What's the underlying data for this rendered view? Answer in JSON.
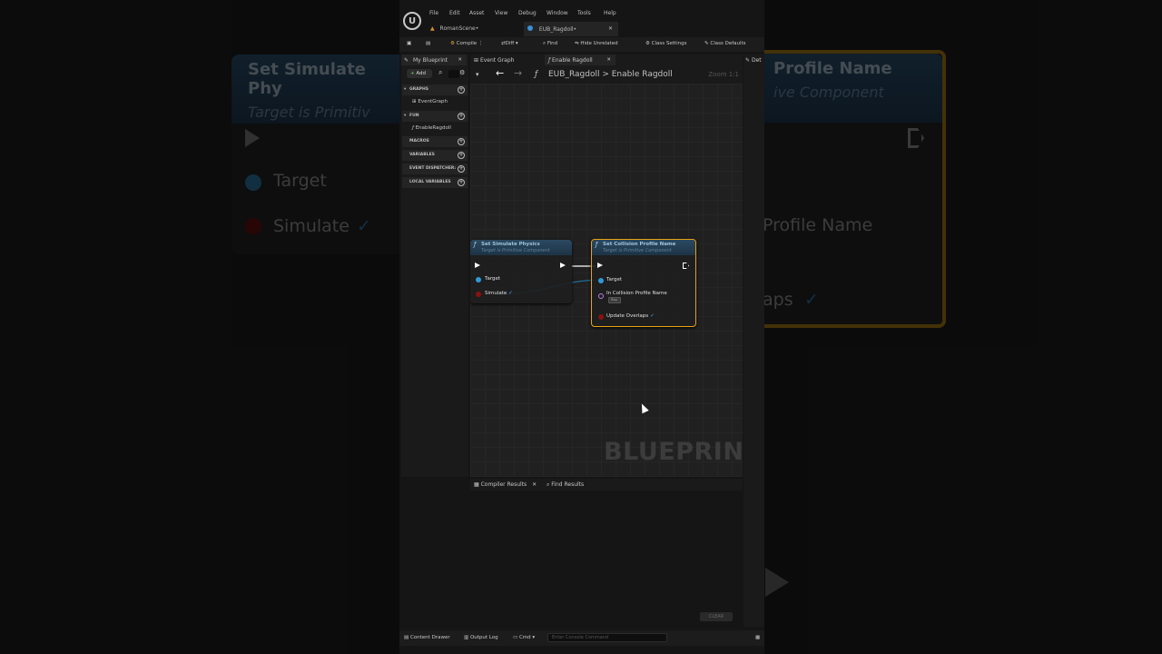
{
  "menu": [
    "File",
    "Edit",
    "Asset",
    "View",
    "Debug",
    "Window",
    "Tools",
    "Help"
  ],
  "doc_tabs": [
    {
      "label": "RomanScene•"
    },
    {
      "label": "EUB_Ragdoll•"
    }
  ],
  "toolbar": {
    "compile": "Compile",
    "diff": "Diff",
    "find": "Find",
    "hide_unrelated": "Hide Unrelated",
    "class_settings": "Class Settings",
    "class_defaults": "Class Defaults"
  },
  "my_blueprint": {
    "tab": "My Blueprint",
    "add": "Add",
    "sections": {
      "graphs": "GRAPHS",
      "functions": "FUN",
      "macros": "MACROS",
      "variables": "VARIABLES",
      "dispatchers": "EVENT DISPATCHER:",
      "local_variables": "LOCAL VARIABLES"
    },
    "graph_entry": "EventGraph",
    "function_entry": "EnableRagdoll"
  },
  "graph_tabs": [
    "Event Graph",
    "Enable Ragdoll"
  ],
  "breadcrumb": {
    "root": "EUB_Ragdoll",
    "separator": ">",
    "current": "Enable Ragdoll",
    "zoom": "Zoom 1:1"
  },
  "nodes": {
    "simulate": {
      "title": "Set Simulate Physics",
      "subtitle": "Target is Primitive Component",
      "target": "Target",
      "simulate": "Simulate"
    },
    "collision": {
      "title": "Set Collision Profile Name",
      "subtitle": "Target is Primitive Component",
      "target": "Target",
      "profile": "In Collision Profile Name",
      "profile_value": "Rag",
      "overlaps": "Update Overlaps"
    }
  },
  "watermark": "BLUEPRINT",
  "bottom_tabs": {
    "compiler": "Compiler Results",
    "find": "Find Results"
  },
  "clear": "CLEAR",
  "details_tab": "Det",
  "statusbar": {
    "content_drawer": "Content Drawer",
    "output_log": "Output Log",
    "cmd": "Cmd",
    "console_placeholder": "Enter Console Command"
  },
  "background": {
    "node_a_title": "Set Simulate Phy",
    "node_a_sub": "Target is Primitiv",
    "node_b_title": "Profile Name",
    "node_b_sub": "ive Component",
    "target": "Target",
    "simulate": "Simulate",
    "profile": "Profile Name",
    "overlaps": "aps"
  }
}
